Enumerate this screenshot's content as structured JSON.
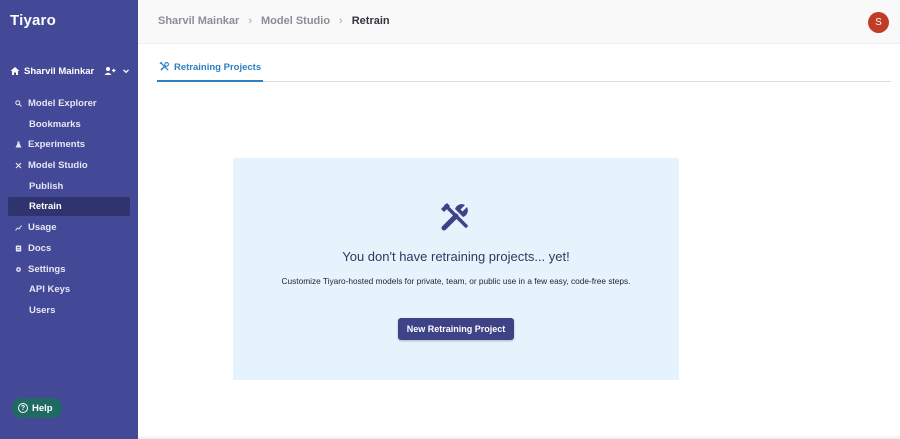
{
  "app": {
    "logo": "Tiyaro"
  },
  "user": {
    "name": "Sharvil Mainkar",
    "avatar_letter": "S",
    "avatar_color": "#c13c24"
  },
  "sidebar": {
    "items": [
      {
        "label": "Model Explorer",
        "icon": "search-icon"
      },
      {
        "label": "Bookmarks"
      },
      {
        "label": "Experiments",
        "icon": "flask-icon"
      },
      {
        "label": "Model Studio",
        "icon": "tools-icon"
      },
      {
        "label": "Publish"
      },
      {
        "label": "Retrain",
        "active": true
      },
      {
        "label": "Usage",
        "icon": "chart-icon"
      },
      {
        "label": "Docs",
        "icon": "document-icon"
      },
      {
        "label": "Settings",
        "icon": "gear-icon"
      },
      {
        "label": "API Keys"
      },
      {
        "label": "Users"
      }
    ],
    "help_label": "Help"
  },
  "breadcrumb": [
    "Sharvil Mainkar",
    "Model Studio",
    "Retrain"
  ],
  "tabs": [
    {
      "label": "Retraining Projects",
      "active": true
    }
  ],
  "empty_state": {
    "title": "You don't have retraining projects... yet!",
    "description": "Customize Tiyaro-hosted models for private, team, or public use in a few easy, code-free steps.",
    "button_label": "New Retraining Project"
  },
  "colors": {
    "sidebar": "#434897",
    "accent": "#2e7fc0",
    "card": "#e6f3fc",
    "button": "#3e4388"
  }
}
